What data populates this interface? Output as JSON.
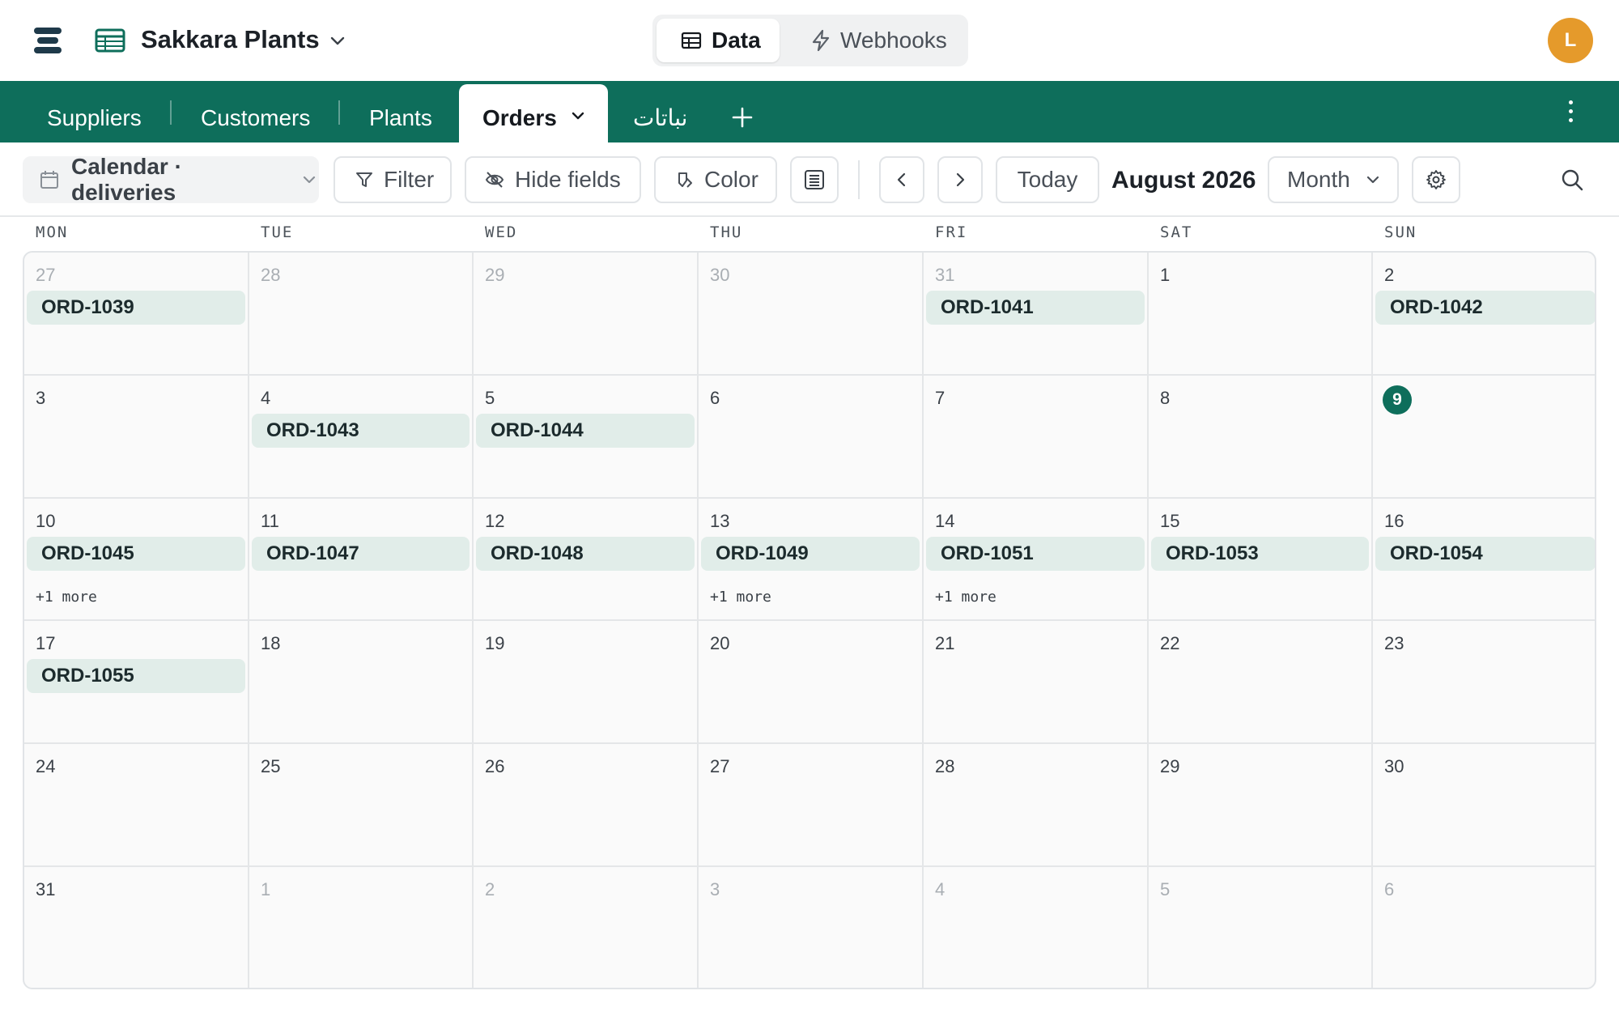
{
  "app": {
    "name": "Sakkara Plants",
    "user_initial": "L"
  },
  "mode_switch": {
    "data_label": "Data",
    "webhooks_label": "Webhooks"
  },
  "tabs": {
    "suppliers": "Suppliers",
    "customers": "Customers",
    "plants": "Plants",
    "orders": "Orders",
    "arabic_plants": "نباتات"
  },
  "toolbar": {
    "view_label": "Calendar · deliveries",
    "filter_label": "Filter",
    "hide_fields_label": "Hide fields",
    "color_label": "Color",
    "today_label": "Today",
    "month_title": "August 2026",
    "range_label": "Month"
  },
  "weekdays": [
    "MON",
    "TUE",
    "WED",
    "THU",
    "FRI",
    "SAT",
    "SUN"
  ],
  "weeks": [
    [
      {
        "day": "27",
        "muted": true,
        "event": "ORD-1039"
      },
      {
        "day": "28",
        "muted": true
      },
      {
        "day": "29",
        "muted": true
      },
      {
        "day": "30",
        "muted": true
      },
      {
        "day": "31",
        "muted": true,
        "event": "ORD-1041"
      },
      {
        "day": "1"
      },
      {
        "day": "2",
        "event": "ORD-1042"
      }
    ],
    [
      {
        "day": "3"
      },
      {
        "day": "4",
        "event": "ORD-1043"
      },
      {
        "day": "5",
        "event": "ORD-1044"
      },
      {
        "day": "6"
      },
      {
        "day": "7"
      },
      {
        "day": "8"
      },
      {
        "day": "9",
        "today": true
      }
    ],
    [
      {
        "day": "10",
        "event": "ORD-1045",
        "more": "+1 more"
      },
      {
        "day": "11",
        "event": "ORD-1047"
      },
      {
        "day": "12",
        "event": "ORD-1048"
      },
      {
        "day": "13",
        "event": "ORD-1049",
        "more": "+1 more"
      },
      {
        "day": "14",
        "event": "ORD-1051",
        "more": "+1 more"
      },
      {
        "day": "15",
        "event": "ORD-1053"
      },
      {
        "day": "16",
        "event": "ORD-1054"
      }
    ],
    [
      {
        "day": "17",
        "event": "ORD-1055"
      },
      {
        "day": "18"
      },
      {
        "day": "19"
      },
      {
        "day": "20"
      },
      {
        "day": "21"
      },
      {
        "day": "22"
      },
      {
        "day": "23"
      }
    ],
    [
      {
        "day": "24"
      },
      {
        "day": "25"
      },
      {
        "day": "26"
      },
      {
        "day": "27"
      },
      {
        "day": "28"
      },
      {
        "day": "29"
      },
      {
        "day": "30"
      }
    ],
    [
      {
        "day": "31"
      },
      {
        "day": "1",
        "muted": true
      },
      {
        "day": "2",
        "muted": true
      },
      {
        "day": "3",
        "muted": true
      },
      {
        "day": "4",
        "muted": true
      },
      {
        "day": "5",
        "muted": true
      },
      {
        "day": "6",
        "muted": true
      }
    ]
  ],
  "colors": {
    "brand": "#0e6e5b",
    "event_bg": "#e1ede9",
    "avatar": "#e59a2b"
  },
  "icons": {
    "logo": "stacked-bars-logo-icon",
    "app": "table-grid-icon",
    "webhooks": "lightning-icon",
    "settings": "gear-icon",
    "search": "search-icon"
  }
}
